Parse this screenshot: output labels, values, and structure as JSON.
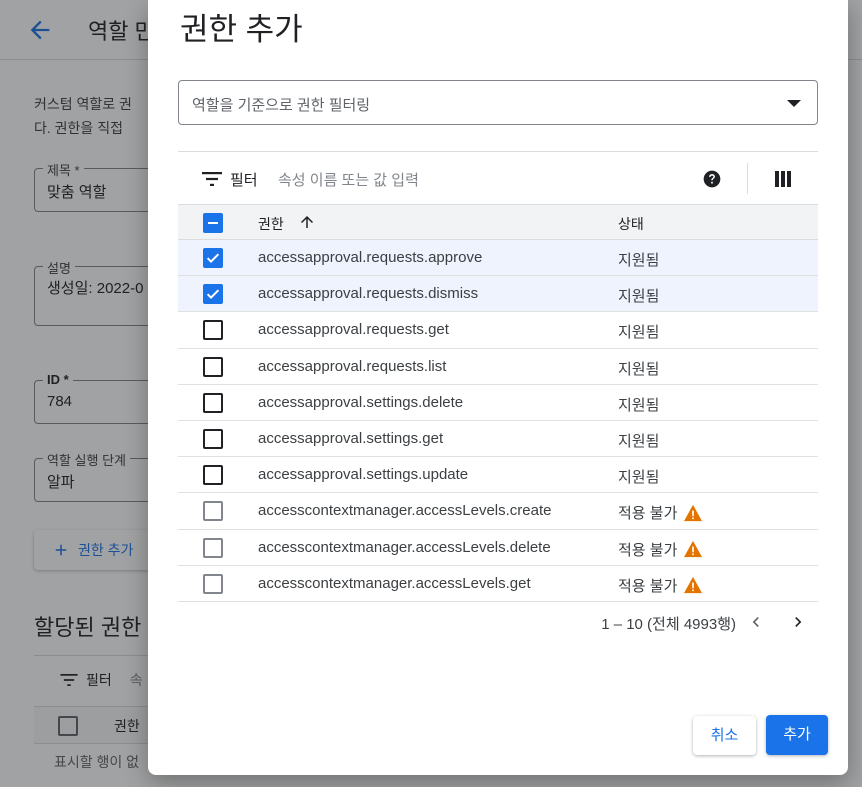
{
  "background": {
    "title": "역할 만",
    "description_lines": [
      "커스텀 역할로 권",
      "다. 권한을 직접"
    ],
    "fields": [
      {
        "label": "제목 *",
        "value": "맞춤 역할"
      },
      {
        "label": "설명",
        "value": "생성일: 2022-0"
      },
      {
        "label": "ID *",
        "value": "784"
      },
      {
        "label": "역할 실행 단계",
        "value": "알파"
      }
    ],
    "add_permission_label": "권한 추가",
    "assigned_section_title": "할당된 권한",
    "filter_label": "필터",
    "filter_placeholder": "속",
    "column_permission": "권한",
    "empty_message": "표시할 행이 없"
  },
  "dialog": {
    "title": "권한 추가",
    "role_filter_placeholder": "역할을 기준으로 권한 필터링",
    "filter_label": "필터",
    "filter_placeholder": "속성 이름 또는 값 입력",
    "columns": {
      "permission": "권한",
      "status": "상태"
    },
    "rows": [
      {
        "permission": "accessapproval.requests.approve",
        "status": "지원됨",
        "checked": true,
        "warning": false
      },
      {
        "permission": "accessapproval.requests.dismiss",
        "status": "지원됨",
        "checked": true,
        "warning": false
      },
      {
        "permission": "accessapproval.requests.get",
        "status": "지원됨",
        "checked": false,
        "warning": false
      },
      {
        "permission": "accessapproval.requests.list",
        "status": "지원됨",
        "checked": false,
        "warning": false
      },
      {
        "permission": "accessapproval.settings.delete",
        "status": "지원됨",
        "checked": false,
        "warning": false
      },
      {
        "permission": "accessapproval.settings.get",
        "status": "지원됨",
        "checked": false,
        "warning": false
      },
      {
        "permission": "accessapproval.settings.update",
        "status": "지원됨",
        "checked": false,
        "warning": false
      },
      {
        "permission": "accesscontextmanager.accessLevels.create",
        "status": "적용 불가",
        "checked": false,
        "warning": true
      },
      {
        "permission": "accesscontextmanager.accessLevels.delete",
        "status": "적용 불가",
        "checked": false,
        "warning": true
      },
      {
        "permission": "accesscontextmanager.accessLevels.get",
        "status": "적용 불가",
        "checked": false,
        "warning": true
      }
    ],
    "pagination": "1 – 10 (전체 4993행)",
    "cancel_label": "취소",
    "add_label": "추가"
  },
  "colors": {
    "accent": "#1a73e8",
    "warning": "#e37400",
    "selected_row": "#eef3fd"
  }
}
